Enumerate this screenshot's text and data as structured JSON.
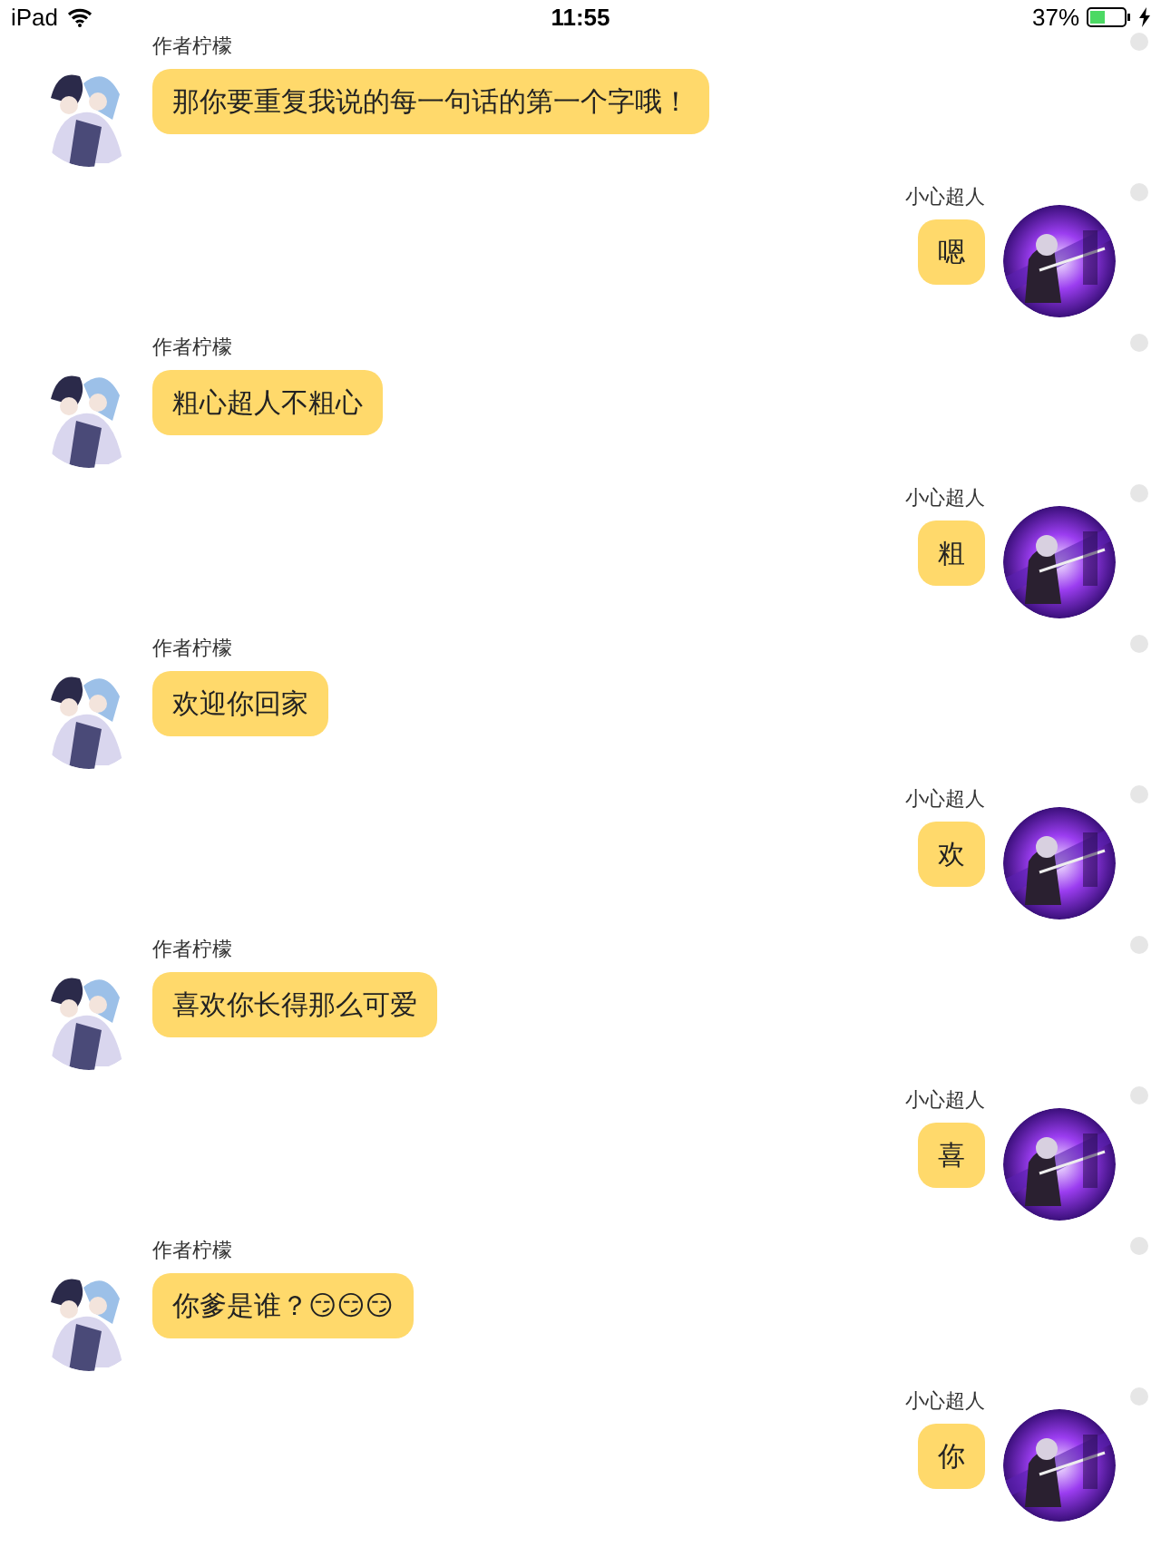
{
  "status_bar": {
    "device": "iPad",
    "time": "11:55",
    "battery": "37%"
  },
  "messages": [
    {
      "kind": "received",
      "name": "作者柠檬",
      "text": "那你要重复我说的每一句话的第一个字哦！"
    },
    {
      "kind": "sent",
      "name": "小心超人",
      "text": "嗯"
    },
    {
      "kind": "received",
      "name": "作者柠檬",
      "text": "粗心超人不粗心"
    },
    {
      "kind": "sent",
      "name": "小心超人",
      "text": "粗"
    },
    {
      "kind": "received",
      "name": "作者柠檬",
      "text": "欢迎你回家"
    },
    {
      "kind": "sent",
      "name": "小心超人",
      "text": "欢"
    },
    {
      "kind": "received",
      "name": "作者柠檬",
      "text": "喜欢你长得那么可爱"
    },
    {
      "kind": "sent",
      "name": "小心超人",
      "text": "喜"
    },
    {
      "kind": "received",
      "name": "作者柠檬",
      "text": "你爹是谁？😏😏😏"
    },
    {
      "kind": "sent",
      "name": "小心超人",
      "text": "你"
    }
  ]
}
